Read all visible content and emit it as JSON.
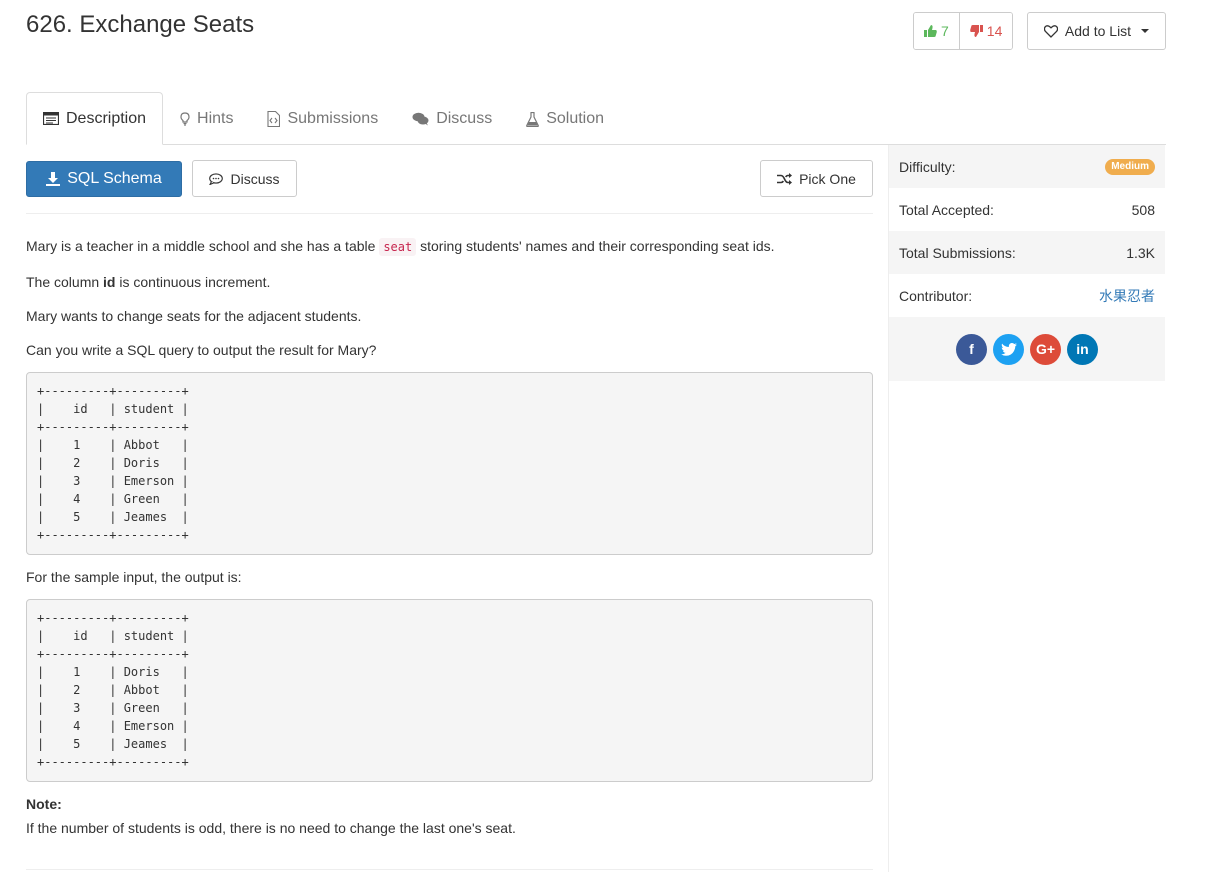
{
  "problem": {
    "title": "626. Exchange Seats",
    "upvotes": "7",
    "downvotes": "14",
    "add_to_list": "Add to List"
  },
  "tabs": [
    {
      "label": "Description",
      "icon": "description-icon",
      "active": true
    },
    {
      "label": "Hints",
      "icon": "lightbulb-icon"
    },
    {
      "label": "Submissions",
      "icon": "code-file-icon"
    },
    {
      "label": "Discuss",
      "icon": "comments-icon"
    },
    {
      "label": "Solution",
      "icon": "flask-icon"
    }
  ],
  "toolbar": {
    "schema_label": "SQL Schema",
    "discuss_label": "Discuss",
    "pick_label": "Pick One"
  },
  "description": {
    "p1_before": "Mary is a teacher in a middle school and she has a table ",
    "p1_code": "seat",
    "p1_after": " storing students' names and their corresponding seat ids.",
    "p2_before": "The column ",
    "p2_bold": "id",
    "p2_after": " is continuous increment.",
    "p3": "Mary wants to change seats for the adjacent students.",
    "p4": "Can you write a SQL query to output the result for Mary?",
    "table_input": "+---------+---------+\n|    id   | student |\n+---------+---------+\n|    1    | Abbot   |\n|    2    | Doris   |\n|    3    | Emerson |\n|    4    | Green   |\n|    5    | Jeames  |\n+---------+---------+",
    "p5": "For the sample input, the output is:",
    "table_output": "+---------+---------+\n|    id   | student |\n+---------+---------+\n|    1    | Doris   |\n|    2    | Abbot   |\n|    3    | Green   |\n|    4    | Emerson |\n|    5    | Jeames  |\n+---------+---------+",
    "note_label": "Note:",
    "note_text": "If the number of students is odd, there is no need to change the last one's seat."
  },
  "sidebar": {
    "difficulty_label": "Difficulty:",
    "difficulty_value": "Medium",
    "accepted_label": "Total Accepted:",
    "accepted_value": "508",
    "submissions_label": "Total Submissions:",
    "submissions_value": "1.3K",
    "contributor_label": "Contributor:",
    "contributor_value": "水果忍者",
    "social": [
      "f",
      "t",
      "G+",
      "in"
    ]
  },
  "colors": {
    "primary": "#337ab7",
    "upvote": "#5cb85c",
    "downvote": "#d9534f",
    "medium_badge": "#f0ad4e",
    "code_text": "#c7254e"
  }
}
